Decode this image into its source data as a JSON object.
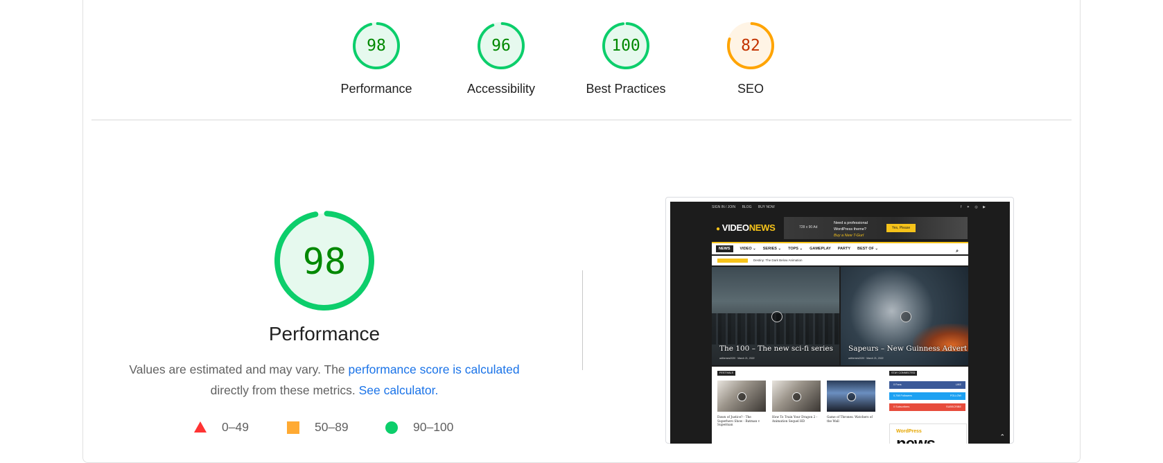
{
  "summary": {
    "gauges": [
      {
        "label": "Performance",
        "score": "98",
        "fraction": 0.98,
        "level": "pass"
      },
      {
        "label": "Accessibility",
        "score": "96",
        "fraction": 0.96,
        "level": "pass"
      },
      {
        "label": "Best Practices",
        "score": "100",
        "fraction": 1.0,
        "level": "pass"
      },
      {
        "label": "SEO",
        "score": "82",
        "fraction": 0.82,
        "level": "average"
      }
    ]
  },
  "performance": {
    "score": "98",
    "fraction": 0.98,
    "title": "Performance",
    "desc_prefix": "Values are estimated and may vary. The ",
    "desc_link": "performance score is calculated",
    "desc_mid": "directly from these metrics. ",
    "desc_link2": "See calculator.",
    "legend": [
      {
        "range": "0–49",
        "shape": "triangle"
      },
      {
        "range": "50–89",
        "shape": "square"
      },
      {
        "range": "90–100",
        "shape": "circle"
      }
    ]
  },
  "colors": {
    "pass": "#0cce6b",
    "pass_text": "#008800",
    "pass_bg": "#e6f9ee",
    "average": "#ffa400",
    "average_text": "#c33300",
    "average_bg": "#fff4e5",
    "fail": "#ff3333",
    "link": "#1a73e8"
  },
  "thumbnail": {
    "topbar_links": [
      "SIGN IN / JOIN",
      "BLOG",
      "BUY NOW"
    ],
    "social_icons": "f ✦ ◎ ▶",
    "logo_prefix": "VIDEO",
    "logo_suffix": "NEWS",
    "ad_size": "728 x 90 Ad",
    "ad_line1": "Need a professional",
    "ad_line2": "WordPress theme?",
    "ad_line3": "Buy a New T-Gurl",
    "ad_button": "Yes, Please",
    "nav": [
      "NEWS",
      "VIDEO ⌄",
      "SERIES ⌄",
      "TOPS ⌄",
      "GAMEPLAY",
      "PARTY",
      "BEST OF ⌄"
    ],
    "trending_text": "Destiny: The Dark Below Animation",
    "hero1_caption": "The 100 – The new sci-fi series",
    "hero1_meta": "adthemes2020 · March 21, 2022",
    "hero2_caption": "Sapeurs – New Guinness Advert",
    "hero2_meta": "adthemes2020 · March 21, 2022",
    "section1": "FESTIVALS",
    "section2": "STAY CONNECTED",
    "cards": [
      "Dawn of Justice? - The Superhero Show - Batman v Superman",
      "How To Train Your Dragon 2 - Animation Sequel HD",
      "Game of Thrones: Watchers of the Wall"
    ],
    "social": [
      {
        "name": "0  Fans",
        "action": "LIKE",
        "color": "#3b5998"
      },
      {
        "name": "0,708  Followers",
        "action": "FOLLOW",
        "color": "#1da1f2"
      },
      {
        "name": "0  Subscribers",
        "action": "SUBSCRIBE",
        "color": "#e74c3c"
      }
    ],
    "wp_small": "WordPress",
    "wp_big": "news"
  }
}
